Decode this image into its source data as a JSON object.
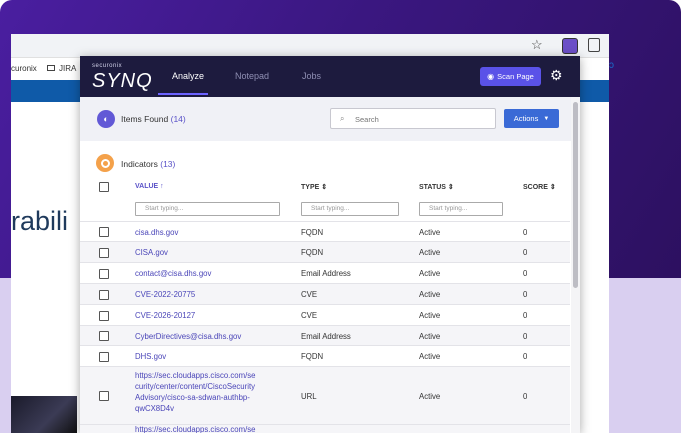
{
  "browser": {
    "bookmarks": [
      "curonix",
      "JIRA"
    ],
    "star_glyph": "☆",
    "page_big_text": "rabili",
    "right_edge_text": "ɔ"
  },
  "ext": {
    "logo_small": "securonix",
    "logo_big": "SYNQ",
    "tabs": [
      "Analyze",
      "Notepad",
      "Jobs"
    ],
    "scan_label": "Scan Page",
    "gear_glyph": "⚙",
    "items_found_label": "Items Found",
    "items_found_count": "(14)",
    "search_placeholder": "Search",
    "actions_label": "Actions",
    "indicators_label": "Indicators",
    "indicators_count": "(13)",
    "columns": {
      "value": "VALUE ↑",
      "type": "TYPE ⇕",
      "status": "STATUS ⇕",
      "score": "SCORE ⇕"
    },
    "filter_placeholder": "Start typing...",
    "rows": [
      {
        "value": "cisa.dhs.gov",
        "type": "FQDN",
        "status": "Active",
        "score": "0"
      },
      {
        "value": "CISA.gov",
        "type": "FQDN",
        "status": "Active",
        "score": "0"
      },
      {
        "value": "contact@cisa.dhs.gov",
        "type": "Email Address",
        "status": "Active",
        "score": "0"
      },
      {
        "value": "CVE-2022-20775",
        "type": "CVE",
        "status": "Active",
        "score": "0"
      },
      {
        "value": "CVE-2026-20127",
        "type": "CVE",
        "status": "Active",
        "score": "0"
      },
      {
        "value": "CyberDirectives@cisa.dhs.gov",
        "type": "Email Address",
        "status": "Active",
        "score": "0"
      },
      {
        "value": "DHS.gov",
        "type": "FQDN",
        "status": "Active",
        "score": "0"
      },
      {
        "value": "https://sec.cloudapps.cisco.com/se curity/center/content/CiscoSecurity Advisory/cisco-sa-sdwan-authbp- qwCX8D4v",
        "type": "URL",
        "status": "Active",
        "score": "0"
      }
    ],
    "truncated_row_text": "https://sec.cloudapps.cisco.com/se"
  }
}
